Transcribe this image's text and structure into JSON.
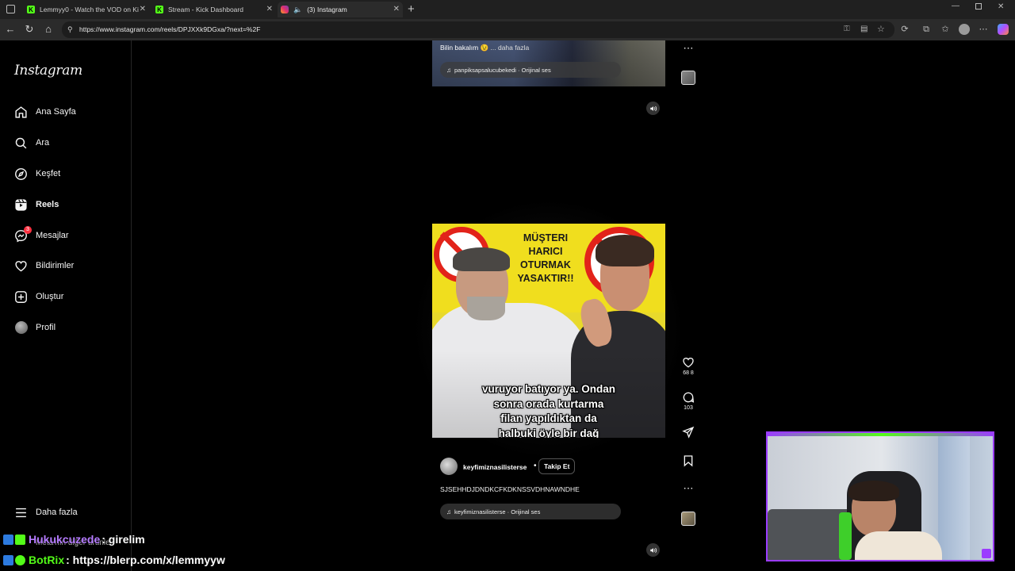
{
  "browser": {
    "tabs": [
      {
        "title": "Lemmyy0 - Watch the VOD on Ki",
        "icon": "kick-icon"
      },
      {
        "title": "Stream - Kick Dashboard",
        "icon": "kick-icon"
      },
      {
        "title": "(3) Instagram",
        "icon": "instagram-icon"
      }
    ],
    "url": "https://www.instagram.com/reels/DPJXXk9DGxa/?next=%2F"
  },
  "sidebar": {
    "logo": "Instagram",
    "items": [
      {
        "label": "Ana Sayfa",
        "icon": "home-icon"
      },
      {
        "label": "Ara",
        "icon": "search-icon"
      },
      {
        "label": "Keşfet",
        "icon": "compass-icon"
      },
      {
        "label": "Reels",
        "icon": "reels-icon"
      },
      {
        "label": "Mesajlar",
        "icon": "messenger-icon",
        "badge": "3"
      },
      {
        "label": "Bildirimler",
        "icon": "heart-icon"
      },
      {
        "label": "Oluştur",
        "icon": "plus-square-icon"
      },
      {
        "label": "Profil",
        "icon": "avatar"
      }
    ],
    "more": "Daha fazla",
    "obscured_text": "Meta'nın diğer ürünle"
  },
  "reel_prev": {
    "caption": "Bilin bakalım 😉",
    "more": "... daha fazla",
    "audio": "panpiksapsalucubekedi · Orijinal ses"
  },
  "reel_main": {
    "sign": [
      "MÜŞTERI",
      "HARICI",
      "OTURMAK",
      "YASAKTIR!!"
    ],
    "subtitles": [
      "vuruyor batıyor ya. Ondan",
      "sonra orada kurtarma",
      "filan yapıldıktan da",
      "halbuki öyle bir dağ"
    ],
    "likes": "68 8",
    "comments": "103",
    "username": "keyfimiznasilisterse",
    "follow": "Takip Et",
    "caption": "SJSEHHDJDNDKCFKDKNSSVDHNAWNDHE",
    "audio": "keyfimiznasilisterse · Orijinal ses"
  },
  "chat": [
    {
      "user": "Hukukcuzede",
      "message": ": girelim",
      "user_color": "#b57bff"
    },
    {
      "user": "BotRix",
      "message": ": https://blerp.com/x/lemmyyw",
      "user_color": "#b57bff"
    }
  ],
  "colors": {
    "accent_purple": "#9b3cff",
    "kick_green": "#53fc18",
    "ig_badge": "#ff3040"
  }
}
